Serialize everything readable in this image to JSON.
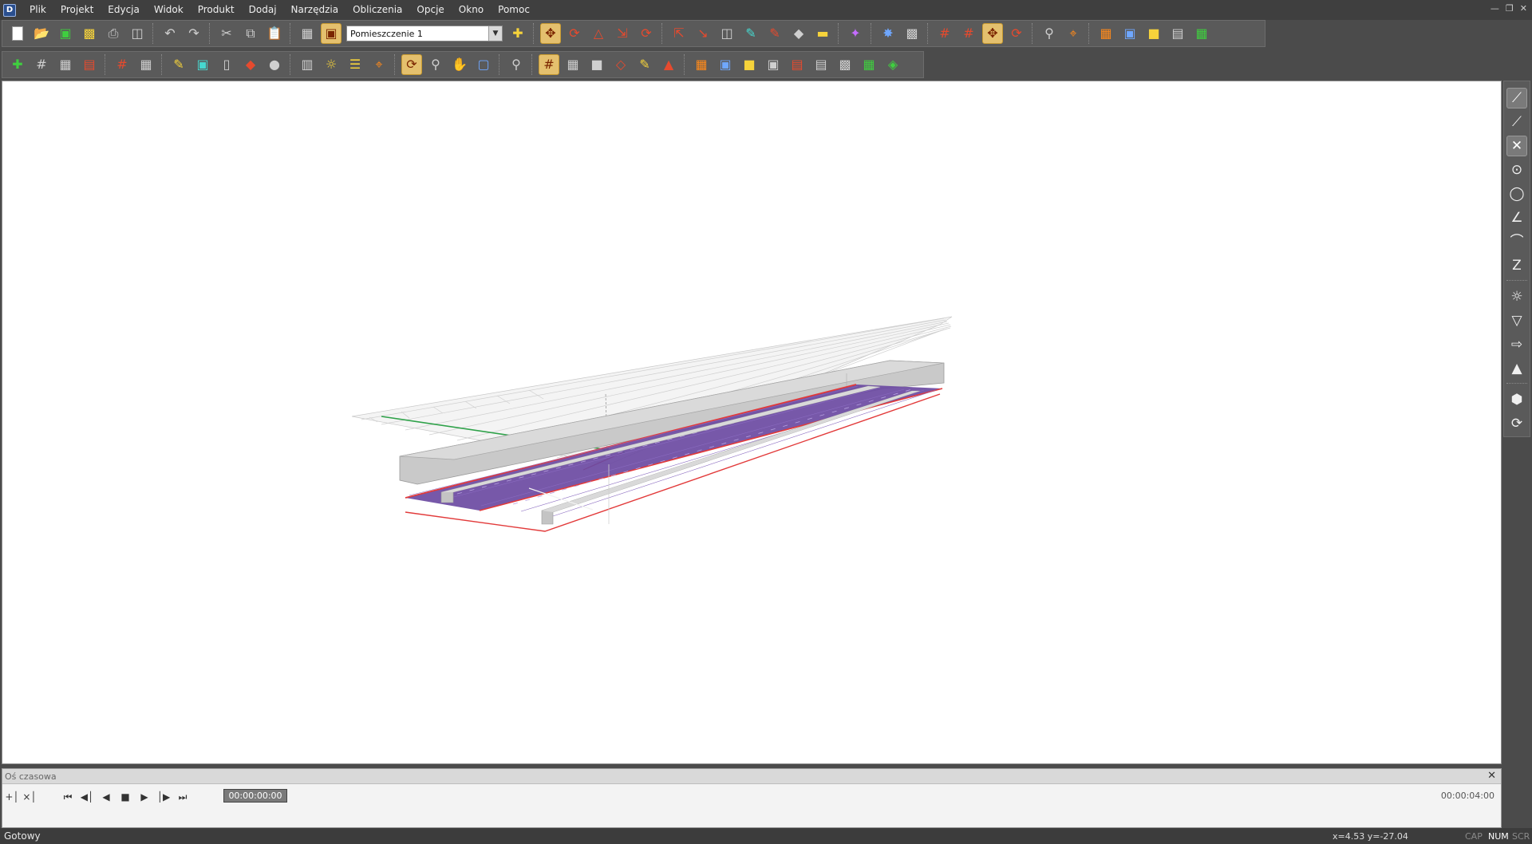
{
  "menu": {
    "items": [
      "Plik",
      "Projekt",
      "Edycja",
      "Widok",
      "Produkt",
      "Dodaj",
      "Narzędzia",
      "Obliczenia",
      "Opcje",
      "Okno",
      "Pomoc"
    ]
  },
  "window_controls": [
    "minimize-icon",
    "restore-icon",
    "close-icon"
  ],
  "toolbar1": {
    "room_select_value": "Pomieszczenie 1",
    "icons": [
      "new-file-icon",
      "open-icon",
      "save-icon",
      "save-as-icon",
      "print-icon",
      "print-preview-icon",
      "undo-icon",
      "redo-icon",
      "cut-icon",
      "copy-icon",
      "paste-icon",
      "building-icon",
      "room-icon",
      "add-room-icon",
      "move-icon",
      "rotate-icon",
      "mirror-icon",
      "scale-icon",
      "array-icon",
      "select-icon",
      "dimension-icon",
      "box-icon",
      "paint-icon",
      "color-icon",
      "material-icon",
      "measure-icon",
      "calculate-icon",
      "luminaire-icon",
      "camera-icon",
      "grid-icon",
      "snap-grid-icon",
      "move-icon",
      "rotate-icon",
      "zoom-icon",
      "layout-icon",
      "view-3d-icon",
      "view-front-icon",
      "document-icon",
      "report-icon"
    ]
  },
  "toolbar2": {
    "icons": [
      "add-object-icon",
      "grid-icon",
      "layers-icon",
      "report-icon",
      "grid-icon",
      "table-icon",
      "pen-icon",
      "box-icon",
      "door-icon",
      "plane-icon",
      "sphere-icon",
      "furniture-icon",
      "bulb-icon",
      "list-icon",
      "arrange-icon",
      "orbit-icon",
      "zoom-icon",
      "pan-icon",
      "zoom-window-icon",
      "zoom-extents-icon",
      "grid-icon",
      "floor-plan-icon",
      "wall-icon",
      "surface-icon",
      "light-icon",
      "calc-grid-icon",
      "layout-icon",
      "view-3d-icon",
      "view-top-icon",
      "view-side-icon",
      "export-icon",
      "document-icon",
      "stamp-icon",
      "green-layout-icon",
      "green-3d-icon"
    ]
  },
  "vtoolbar": {
    "icons": [
      "line-icon",
      "polyline-icon",
      "cross-icon",
      "circle-icon",
      "circle-alt-icon",
      "angle-icon",
      "arc-icon",
      "zigzag-icon",
      "luminaire-icon",
      "lamp-icon",
      "spot-icon",
      "pendant-icon",
      "cube-icon",
      "refresh-icon"
    ]
  },
  "timeline": {
    "title": "Oś czasowa",
    "current_time": "00:00:00:00",
    "end_time": "00:00:04:00",
    "controls": [
      "add-keyframe-icon",
      "remove-keyframe-icon",
      "first-frame-icon",
      "prev-frame-icon",
      "play-back-icon",
      "stop-icon",
      "play-icon",
      "next-frame-icon",
      "last-frame-icon"
    ]
  },
  "statusbar": {
    "text": "Gotowy",
    "coords": "x=4.53 y=-27.04",
    "cap": "CAP",
    "num": "NUM",
    "scr": "SCR"
  }
}
